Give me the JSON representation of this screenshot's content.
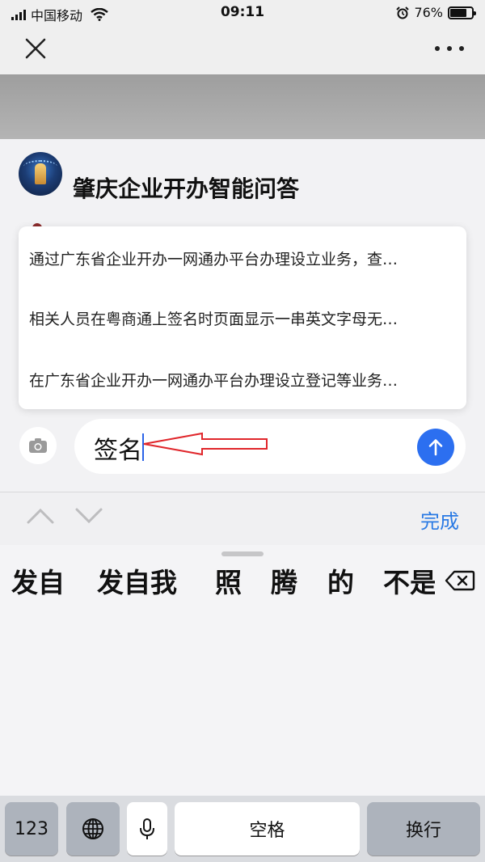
{
  "status_bar": {
    "carrier": "中国移动",
    "time": "09:11",
    "battery_percent": "76%",
    "battery_level": 0.76
  },
  "nav": {
    "close_icon": "close-icon",
    "more_icon": "more-dots-icon"
  },
  "chat": {
    "bot_title": "肇庆企业开办智能问答",
    "suggestions": [
      "通过广东省企业开办一网通办平台办理设立业务，查…",
      "相关人员在粤商通上签名时页面显示一串英文字母无…",
      "在广东省企业开办一网通办平台办理设立登记等业务…"
    ],
    "input_value": "签名"
  },
  "accessory": {
    "done_label": "完成"
  },
  "keyboard": {
    "candidates": [
      "发自",
      "发自我",
      "照",
      "腾",
      "的",
      "不是"
    ],
    "keys": {
      "numbers": "123",
      "space": "空格",
      "return": "换行"
    }
  },
  "colors": {
    "accent_blue": "#2c6ff0",
    "done_blue": "#2a7ae4",
    "annotation_red": "#e0262b"
  }
}
